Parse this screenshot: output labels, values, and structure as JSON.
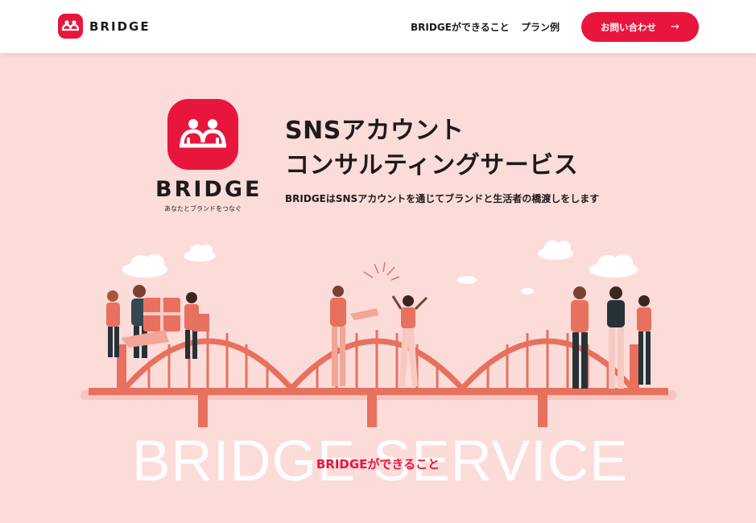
{
  "header": {
    "brand_name": "BRIDGE",
    "nav": [
      {
        "label": "BRIDGEができること"
      },
      {
        "label": "プラン例"
      }
    ],
    "cta_label": "お問い合わせ",
    "cta_icon": "arrow-right-icon"
  },
  "hero": {
    "logo_name": "BRIDGE",
    "logo_tagline": "あなたとブランドをつなぐ",
    "title_line1": "SNSアカウント",
    "title_line2": "コンサルティングサービス",
    "lead": "BRIDGEはSNSアカウントを通じてブランドと生活者の橋渡しをします"
  },
  "section": {
    "background_word": "BRIDGE  SERVICE",
    "title": "BRIDGEができること"
  },
  "colors": {
    "brand_red": "#e8163d",
    "hero_bg": "#fcdcd9",
    "bridge_coral": "#e8705f"
  }
}
